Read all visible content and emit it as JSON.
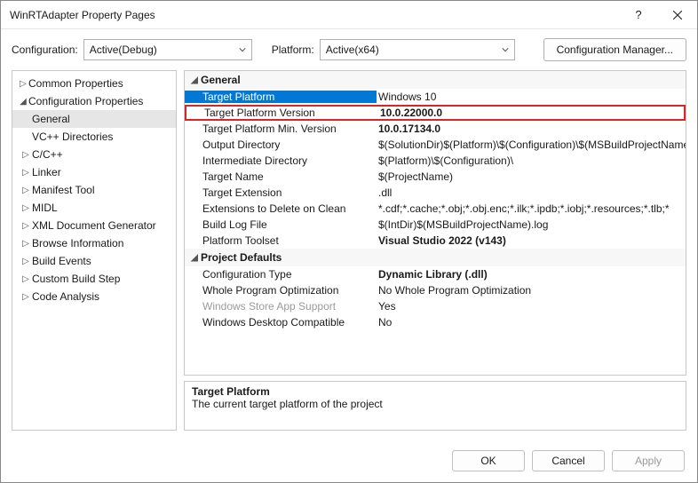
{
  "window": {
    "title": "WinRTAdapter Property Pages"
  },
  "config_row": {
    "configuration_label": "Configuration:",
    "configuration_value": "Active(Debug)",
    "platform_label": "Platform:",
    "platform_value": "Active(x64)",
    "manager_button": "Configuration Manager..."
  },
  "tree": {
    "items": [
      {
        "label": "Common Properties",
        "level": 0,
        "expand": "collapsed"
      },
      {
        "label": "Configuration Properties",
        "level": 0,
        "expand": "expanded"
      },
      {
        "label": "General",
        "level": 1,
        "selected": true
      },
      {
        "label": "VC++ Directories",
        "level": 1
      },
      {
        "label": "C/C++",
        "level": 1,
        "expand": "collapsed"
      },
      {
        "label": "Linker",
        "level": 1,
        "expand": "collapsed"
      },
      {
        "label": "Manifest Tool",
        "level": 1,
        "expand": "collapsed"
      },
      {
        "label": "MIDL",
        "level": 1,
        "expand": "collapsed"
      },
      {
        "label": "XML Document Generator",
        "level": 1,
        "expand": "collapsed"
      },
      {
        "label": "Browse Information",
        "level": 1,
        "expand": "collapsed"
      },
      {
        "label": "Build Events",
        "level": 1,
        "expand": "collapsed"
      },
      {
        "label": "Custom Build Step",
        "level": 1,
        "expand": "collapsed"
      },
      {
        "label": "Code Analysis",
        "level": 1,
        "expand": "collapsed"
      }
    ]
  },
  "sections": [
    {
      "title": "General",
      "rows": [
        {
          "name": "Target Platform",
          "value": "Windows 10",
          "selected": true
        },
        {
          "name": "Target Platform Version",
          "value": "10.0.22000.0",
          "bold": true,
          "highlight": true
        },
        {
          "name": "Target Platform Min. Version",
          "value": "10.0.17134.0",
          "bold": true
        },
        {
          "name": "Output Directory",
          "value": "$(SolutionDir)$(Platform)\\$(Configuration)\\$(MSBuildProjectName)\\"
        },
        {
          "name": "Intermediate Directory",
          "value": "$(Platform)\\$(Configuration)\\"
        },
        {
          "name": "Target Name",
          "value": "$(ProjectName)"
        },
        {
          "name": "Target Extension",
          "value": ".dll"
        },
        {
          "name": "Extensions to Delete on Clean",
          "value": "*.cdf;*.cache;*.obj;*.obj.enc;*.ilk;*.ipdb;*.iobj;*.resources;*.tlb;*"
        },
        {
          "name": "Build Log File",
          "value": "$(IntDir)$(MSBuildProjectName).log"
        },
        {
          "name": "Platform Toolset",
          "value": "Visual Studio 2022 (v143)",
          "bold": true
        }
      ]
    },
    {
      "title": "Project Defaults",
      "rows": [
        {
          "name": "Configuration Type",
          "value": "Dynamic Library (.dll)",
          "bold": true
        },
        {
          "name": "Whole Program Optimization",
          "value": "No Whole Program Optimization"
        },
        {
          "name": "Windows Store App Support",
          "value": "Yes",
          "disabled": true
        },
        {
          "name": "Windows Desktop Compatible",
          "value": "No"
        }
      ]
    }
  ],
  "description": {
    "title": "Target Platform",
    "text": "The current target platform of the project"
  },
  "footer": {
    "ok": "OK",
    "cancel": "Cancel",
    "apply": "Apply"
  }
}
